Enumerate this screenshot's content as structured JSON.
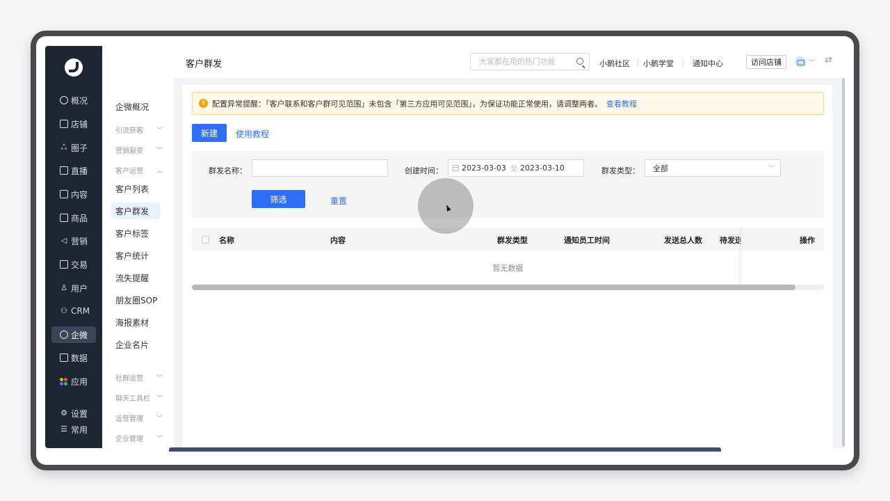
{
  "app": {
    "page_title": "客户群发"
  },
  "main_nav": {
    "items": [
      {
        "label": "概况",
        "icon": "pie-chart-icon"
      },
      {
        "label": "店铺",
        "icon": "store-icon"
      },
      {
        "label": "圈子",
        "icon": "group-icon"
      },
      {
        "label": "直播",
        "icon": "live-icon"
      },
      {
        "label": "内容",
        "icon": "document-icon"
      },
      {
        "label": "商品",
        "icon": "product-icon"
      },
      {
        "label": "营销",
        "icon": "megaphone-icon"
      },
      {
        "label": "交易",
        "icon": "transaction-icon"
      },
      {
        "label": "用户",
        "icon": "user-icon"
      },
      {
        "label": "CRM",
        "icon": "crm-icon"
      },
      {
        "label": "企微",
        "icon": "wecom-icon",
        "active": true
      },
      {
        "label": "数据",
        "icon": "data-icon"
      },
      {
        "label": "应用",
        "icon": "apps-icon"
      },
      {
        "label": "设置",
        "icon": "settings-icon"
      },
      {
        "label": "常用",
        "icon": "list-icon"
      }
    ]
  },
  "sub_nav": {
    "overview": "企微概况",
    "groups": [
      {
        "label": "引流获客",
        "expanded": false
      },
      {
        "label": "营销裂变",
        "expanded": false
      },
      {
        "label": "客户运营",
        "expanded": true
      }
    ],
    "items": [
      "客户列表",
      "客户群发",
      "客户标签",
      "客户统计",
      "流失提醒",
      "朋友圈SOP",
      "海报素材",
      "企业名片"
    ],
    "active_item": "客户群发",
    "more_groups": [
      "社群运营",
      "聊天工具栏",
      "运营管理",
      "企业管理"
    ]
  },
  "header": {
    "search_placeholder": "大家都在用的热门功能",
    "links": [
      "小鹅社区",
      "小鹅学堂",
      "通知中心"
    ],
    "visit_store": "访问店铺"
  },
  "alert": {
    "text": "配置异常提醒：「客户联系和客户群可见范围」未包含「第三方应用可见范围」，为保证功能正常使用，请调整两者。",
    "link": "查看教程"
  },
  "actions": {
    "new_button": "新建",
    "tutorial_link": "使用教程"
  },
  "filters": {
    "name_label": "群发名称：",
    "name_value": "",
    "time_label": "创建时间：",
    "date_start": "2023-03-03",
    "date_sep": "至",
    "date_end": "2023-03-10",
    "type_label": "群发类型：",
    "type_value": "全部",
    "filter_button": "筛选",
    "reset_link": "重置"
  },
  "table": {
    "columns": [
      "名称",
      "内容",
      "群发类型",
      "通知员工时间",
      "发送总人数",
      "待发送",
      "操作"
    ],
    "empty_text": "暂无数据"
  },
  "colors": {
    "sidebar": "#1e2533",
    "primary": "#2f6ef5",
    "warning": "#f6a20e"
  }
}
